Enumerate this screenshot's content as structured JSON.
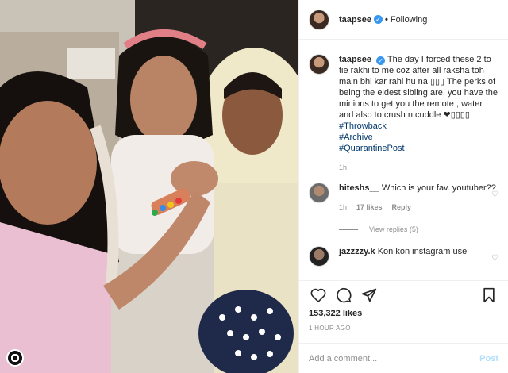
{
  "post": {
    "username": "taapsee",
    "verified_glyph": "✓",
    "separator": "•",
    "follow_status": "Following"
  },
  "caption": {
    "username": "taapsee",
    "text": "The day I forced these 2 to tie rakhi to me coz after all raksha toh main bhi kar rahi hu na ▯▯▯ The perks of being the eldest sibling are, you have the minions to get you the remote , water and also to crush n cuddle ❤▯▯▯▯",
    "tags": [
      "#Throwback",
      "#Archive",
      "#QuarantinePost"
    ],
    "time": "1h"
  },
  "comments": [
    {
      "username": "hiteshs__",
      "text": "Which is your fav. youtuber??",
      "time": "1h",
      "likes": "17 likes",
      "reply_label": "Reply",
      "view_replies": "View replies (5)"
    },
    {
      "username": "jazzzzy.k",
      "text": "Kon kon instagram use"
    }
  ],
  "actions": {
    "like_icon": "heart-icon",
    "comment_icon": "comment-icon",
    "share_icon": "share-icon",
    "save_icon": "bookmark-icon"
  },
  "likes_count": "153,322 likes",
  "timestamp": "1 HOUR AGO",
  "add_comment": {
    "placeholder": "Add a comment...",
    "post_label": "Post"
  },
  "colors": {
    "link": "#00376b",
    "verified": "#3897f0",
    "muted": "#8e8e8e",
    "post_button": "#b2dffc"
  }
}
